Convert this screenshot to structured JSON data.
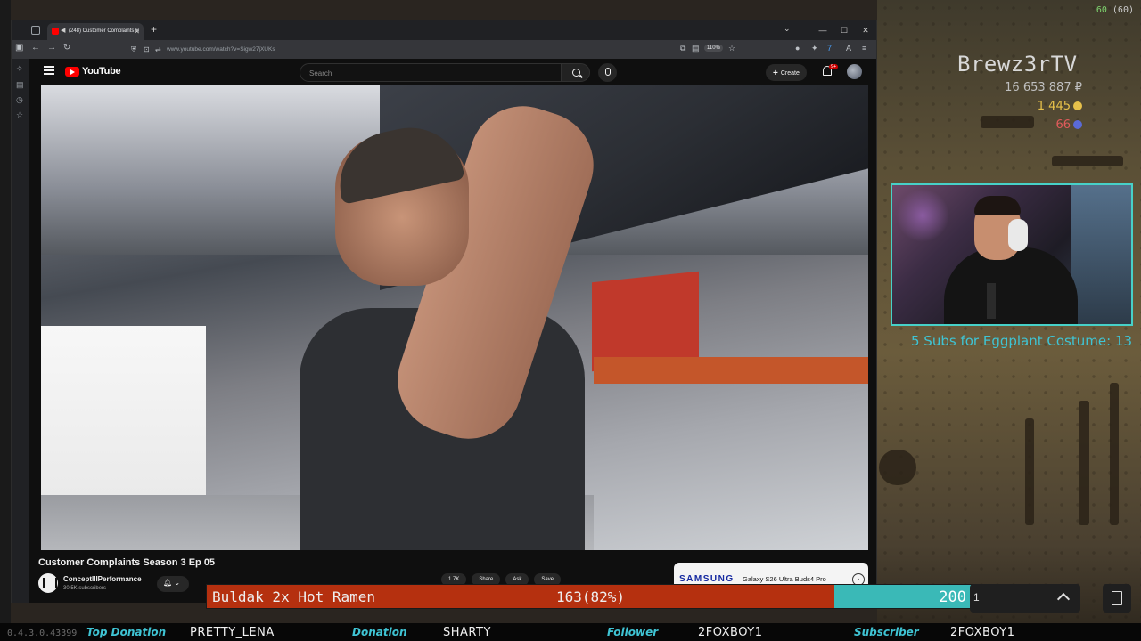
{
  "fps": {
    "value": "60",
    "paren": "(60)"
  },
  "streamer": {
    "name": "Brewz3rTV",
    "stat_points": "16 653 887 ₽",
    "stat_coins": "1 445",
    "stat_red": "66",
    "subs_goal": "5 Subs for Eggplant Costume: 13"
  },
  "browser": {
    "tab_title": "(248) Customer Complaints S",
    "url": "www.youtube.com/watch?v=Sigw27jXUKs",
    "zoom": "110%"
  },
  "youtube": {
    "logo": "YouTube",
    "search_placeholder": "Search",
    "create_label": "Create",
    "notif_badge": "9+",
    "video_title": "Customer Complaints Season 3 Ep 05",
    "channel_name": "ConceptIIIPerformance",
    "subscribers": "30.5K subscribers",
    "actions": [
      "1.7K",
      "Share",
      "Ask",
      "Save"
    ],
    "ad_brand": "SAMSUNG",
    "ad_product": "Galaxy S26 Ultra Buds4 Pro"
  },
  "ramen": {
    "name": "Buldak 2x Hot Ramen",
    "count": "163(82%)",
    "goal": "200",
    "progress": 0.82
  },
  "chat_count": "1",
  "version": "0.4.3.0.43399",
  "ticker": {
    "top_donation_label": "Top Donation",
    "top_donation_value": "PRETTY_LENA",
    "donation_label": "Donation",
    "donation_value": "SHARTY",
    "follower_label": "Follower",
    "follower_value": "2FOXBOY1",
    "subscriber_label": "Subscriber",
    "subscriber_value": "2FOXBOY1"
  }
}
